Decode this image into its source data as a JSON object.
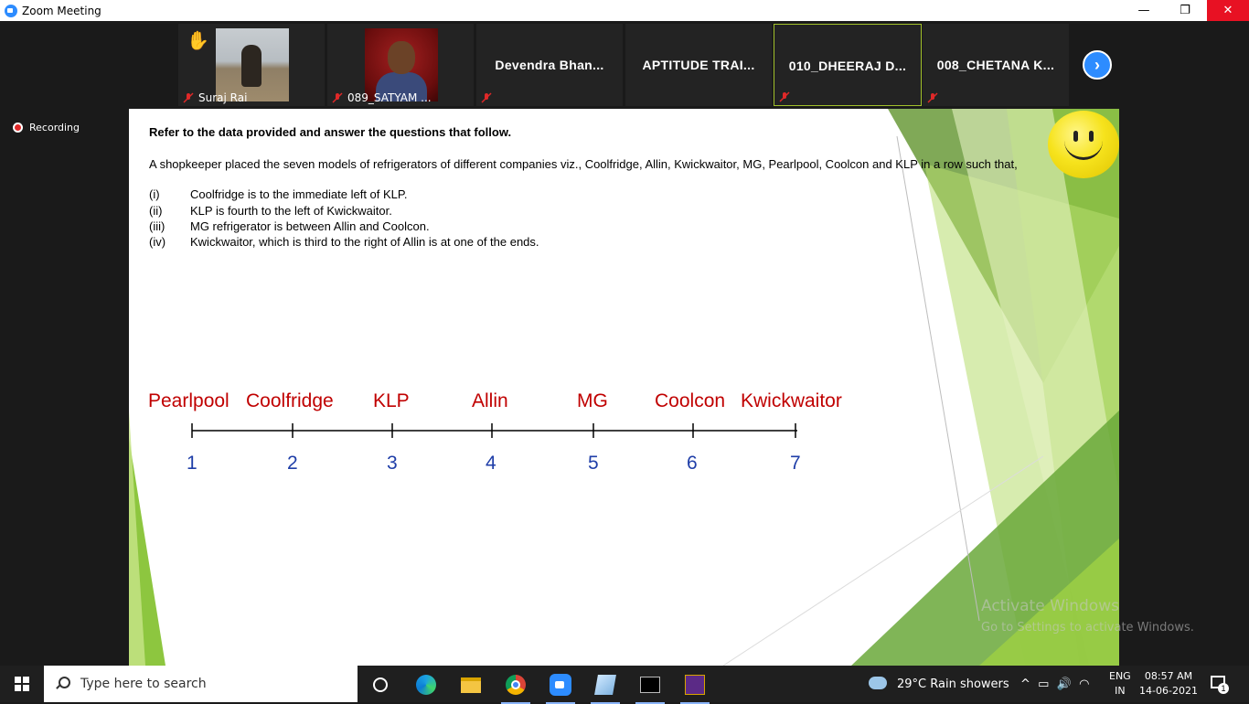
{
  "window": {
    "title": "Zoom Meeting",
    "minimize": "—",
    "maximize": "❐",
    "close": "✕"
  },
  "participants": [
    {
      "name": "Suraj Rai",
      "type": "video",
      "raised_hand": true
    },
    {
      "name": "089_SATYAM ...",
      "type": "video"
    },
    {
      "name": "Devendra  Bhan...",
      "type": "name"
    },
    {
      "name": "APTITUDE TRAI...",
      "type": "name"
    },
    {
      "name": "010_DHEERAJ D...",
      "type": "name",
      "active": true
    },
    {
      "name": "008_CHETANA K...",
      "type": "name"
    }
  ],
  "recording": {
    "label": "Recording"
  },
  "slide": {
    "heading": "Refer to the data provided and answer the questions that follow.",
    "paragraph": "A shopkeeper placed the seven models of refrigerators of different companies viz., Coolfridge, Allin, Kwickwaitor, MG, Pearlpool, Coolcon and KLP in a row such that,",
    "clues": [
      {
        "num": "(i)",
        "text": "Coolfridge is to the immediate left of KLP."
      },
      {
        "num": "(ii)",
        "text": "KLP is fourth to the left of Kwickwaitor."
      },
      {
        "num": "(iii)",
        "text": "MG refrigerator is between Allin and Coolcon."
      },
      {
        "num": "(iv)",
        "text": "Kwickwaitor, which is third to the right of Allin is at one of the ends."
      }
    ],
    "arrangement": [
      {
        "brand": "Pearlpool",
        "position": "1"
      },
      {
        "brand": "Coolfridge",
        "position": "2"
      },
      {
        "brand": "KLP",
        "position": "3"
      },
      {
        "brand": "Allin",
        "position": "4"
      },
      {
        "brand": "MG",
        "position": "5"
      },
      {
        "brand": "Coolcon",
        "position": "6"
      },
      {
        "brand": "Kwickwaitor",
        "position": "7"
      }
    ]
  },
  "watermark": {
    "line1": "Activate Windows",
    "line2": "Go to Settings to activate Windows."
  },
  "taskbar": {
    "search_placeholder": "Type here to search",
    "weather": "29°C  Rain showers",
    "lang_line1": "ENG",
    "lang_line2": "IN",
    "time": "08:57 AM",
    "date": "14-06-2021",
    "notification_count": "1"
  },
  "colors": {
    "accent_green": "#8dc63f",
    "brand_red": "#c00000",
    "number_blue": "#1f3ea8",
    "zoom_blue": "#2d8cff"
  }
}
